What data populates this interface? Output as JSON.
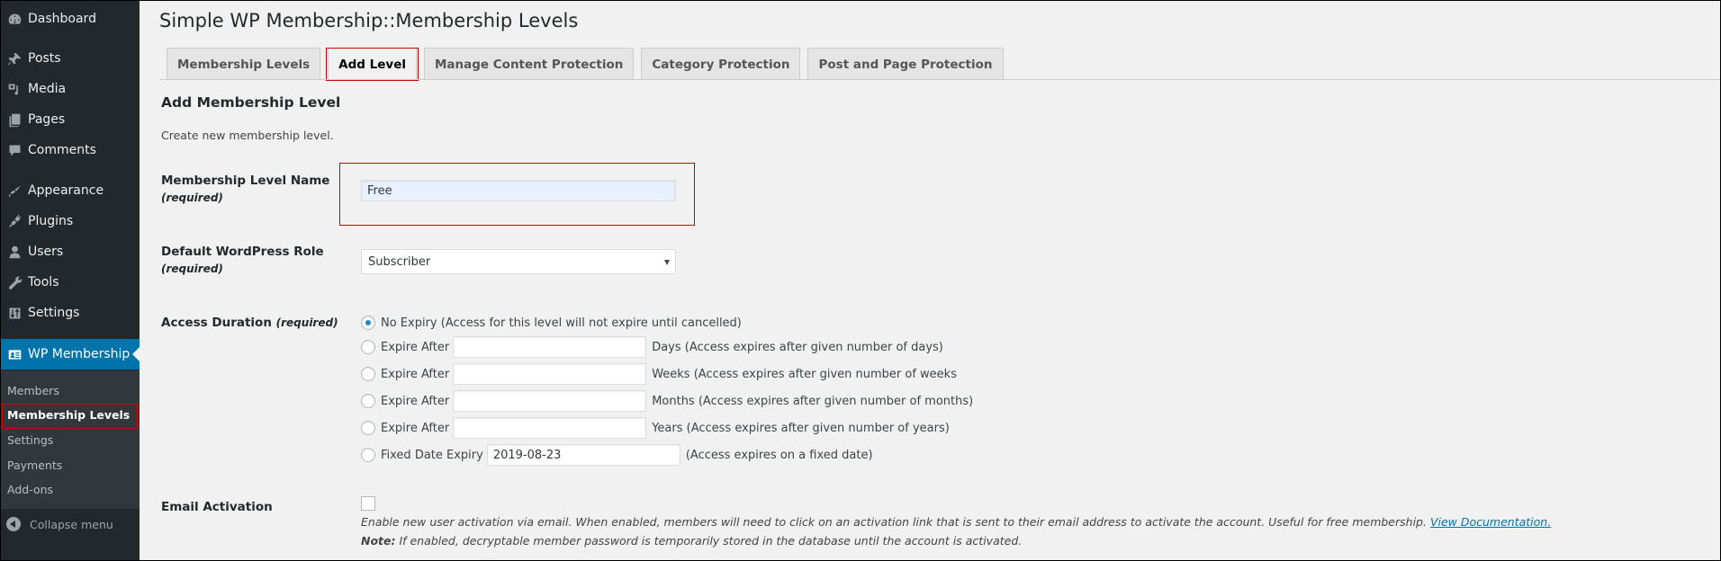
{
  "sidebar": {
    "items": [
      {
        "label": "Dashboard",
        "icon": "dashboard-icon"
      },
      {
        "label": "Posts",
        "icon": "pin-icon"
      },
      {
        "label": "Media",
        "icon": "media-icon"
      },
      {
        "label": "Pages",
        "icon": "pages-icon"
      },
      {
        "label": "Comments",
        "icon": "comment-icon"
      },
      {
        "label": "Appearance",
        "icon": "paintbrush-icon"
      },
      {
        "label": "Plugins",
        "icon": "plugin-icon"
      },
      {
        "label": "Users",
        "icon": "user-icon"
      },
      {
        "label": "Tools",
        "icon": "wrench-icon"
      },
      {
        "label": "Settings",
        "icon": "settings-icon"
      },
      {
        "label": "WP Membership",
        "icon": "id-card-icon"
      }
    ],
    "submenu": [
      "Members",
      "Membership Levels",
      "Settings",
      "Payments",
      "Add-ons"
    ],
    "collapse_label": "Collapse menu"
  },
  "page": {
    "title": "Simple WP Membership::Membership Levels",
    "tabs": [
      "Membership Levels",
      "Add Level",
      "Manage Content Protection",
      "Category Protection",
      "Post and Page Protection"
    ],
    "active_tab": "Add Level"
  },
  "form": {
    "title": "Add Membership Level",
    "description": "Create new membership level.",
    "required_note": "(required)",
    "level_name": {
      "label": "Membership Level Name",
      "value": "Free"
    },
    "role": {
      "label": "Default WordPress Role",
      "value": "Subscriber"
    },
    "access_duration": {
      "label": "Access Duration",
      "options": [
        {
          "label": "No Expiry (Access for this level will not expire until cancelled)",
          "checked": true
        },
        {
          "label": "Expire After",
          "value": "",
          "suffix": "Days (Access expires after given number of days)",
          "checked": false
        },
        {
          "label": "Expire After",
          "value": "",
          "suffix": "Weeks (Access expires after given number of weeks",
          "checked": false
        },
        {
          "label": "Expire After",
          "value": "",
          "suffix": "Months (Access expires after given number of months)",
          "checked": false
        },
        {
          "label": "Expire After",
          "value": "",
          "suffix": "Years (Access expires after given number of years)",
          "checked": false
        },
        {
          "label": "Fixed Date Expiry",
          "value": "2019-08-23",
          "suffix": "(Access expires on a fixed date)",
          "checked": false
        }
      ]
    },
    "email_activation": {
      "label": "Email Activation",
      "checked": false,
      "help": "Enable new user activation via email. When enabled, members will need to click on an activation link that is sent to their email address to activate the account. Useful for free membership.",
      "link": "View Documentation.",
      "note_label": "Note:",
      "note": "If enabled, decryptable member password is temporarily stored in the database until the account is activated."
    }
  },
  "colors": {
    "sidebar_bg": "#23282d",
    "submenu_bg": "#32373c",
    "active_menu": "#0073aa",
    "highlight": "#d40000",
    "link": "#0073aa"
  }
}
